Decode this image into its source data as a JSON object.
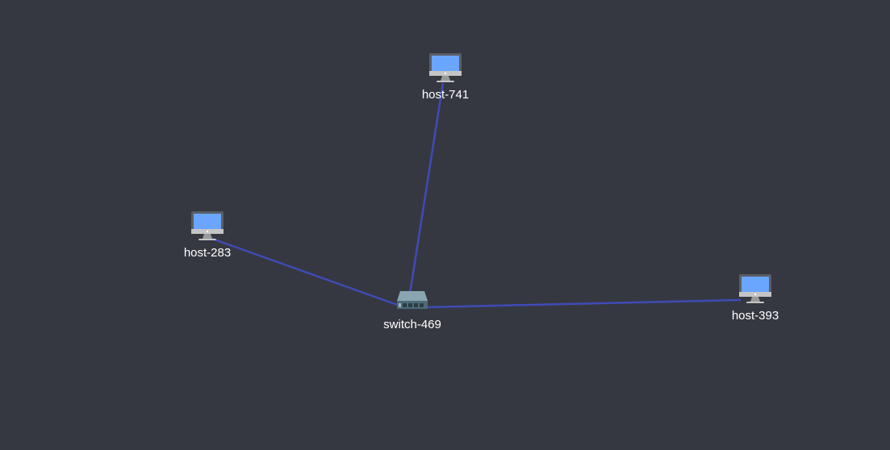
{
  "colors": {
    "background": "#353841",
    "link": "#3f4bb5",
    "label": "#ffffff",
    "screen": "#6aa6fd",
    "monitor_frame": "#5b5e66",
    "stand": "#c5c5c5",
    "switch_body": "#4d6a78",
    "switch_top": "#8aa5b2"
  },
  "nodes": [
    {
      "id": "host-741",
      "type": "host",
      "label": "host-741",
      "icon": "computer-icon"
    },
    {
      "id": "host-283",
      "type": "host",
      "label": "host-283",
      "icon": "computer-icon"
    },
    {
      "id": "switch-469",
      "type": "switch",
      "label": "switch-469",
      "icon": "network-switch-icon"
    },
    {
      "id": "host-393",
      "type": "host",
      "label": "host-393",
      "icon": "computer-icon"
    }
  ],
  "links": [
    {
      "source": "switch-469",
      "target": "host-741"
    },
    {
      "source": "switch-469",
      "target": "host-283"
    },
    {
      "source": "switch-469",
      "target": "host-393"
    }
  ]
}
